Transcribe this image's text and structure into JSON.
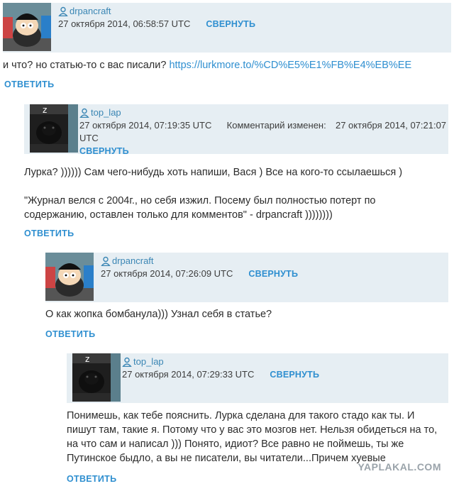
{
  "comments": [
    {
      "username": "drpancraft",
      "date": "27 октября 2014, 06:58:57 UTC",
      "collapse_label": "СВЕРНУТЬ",
      "text": "и что? но статью-то с вас писали?",
      "link": "https://lurkmore.to/%CD%E5%E1%FB%E4%EB%EE",
      "reply_label": "ОТВЕТИТЬ",
      "avatar_icon": "cartman-avatar-icon"
    },
    {
      "username": "top_lap",
      "date": "27 октября 2014, 07:19:35 UTC",
      "edited_label": "Комментарий изменен:",
      "edited_date": "27 октября 2014, 07:21:07",
      "edited_tz": "UTC",
      "collapse_label": "СВЕРНУТЬ",
      "text_line1": "Лурка? )))))) Сам чего-нибудь хоть напиши, Вася ) Все на кого-то ссылаешься )",
      "text_line2": "\"Журнал велся с 2004г., но себя изжил. Посему был полностью потерт по",
      "text_line3": "содержанию, оставлен только для комментов\" - drpancraft ))))))))",
      "reply_label": "ОТВЕТИТЬ",
      "avatar_icon": "black-dog-avatar-icon"
    },
    {
      "username": "drpancraft",
      "date": "27 октября 2014, 07:26:09 UTC",
      "collapse_label": "СВЕРНУТЬ",
      "text": "О как жопка бомбанула))) Узнал себя в статье?",
      "reply_label": "ОТВЕТИТЬ",
      "avatar_icon": "cartman-avatar-icon"
    },
    {
      "username": "top_lap",
      "date": "27 октября 2014, 07:29:33 UTC",
      "collapse_label": "СВЕРНУТЬ",
      "text_line1": "Понимешь, как тебе пояснить. Лурка сделана для такого стадо как ты. И",
      "text_line2": "пишут там, такие я. Потому что у вас это мозгов нет. Нельзя обидеться на то,",
      "text_line3": "на что сам и написал ))) Понято, идиот? Все равно не поймешь, ты же",
      "text_line4": "Путинское быдло, а вы не писатели, вы читатели...Причем хуевые",
      "reply_label": "ОТВЕТИТЬ",
      "avatar_icon": "black-dog-avatar-icon"
    }
  ],
  "watermark": "YAPLAKAL.COM",
  "colors": {
    "accent": "#2f8fd0",
    "header_bg": "#e6eef3"
  }
}
